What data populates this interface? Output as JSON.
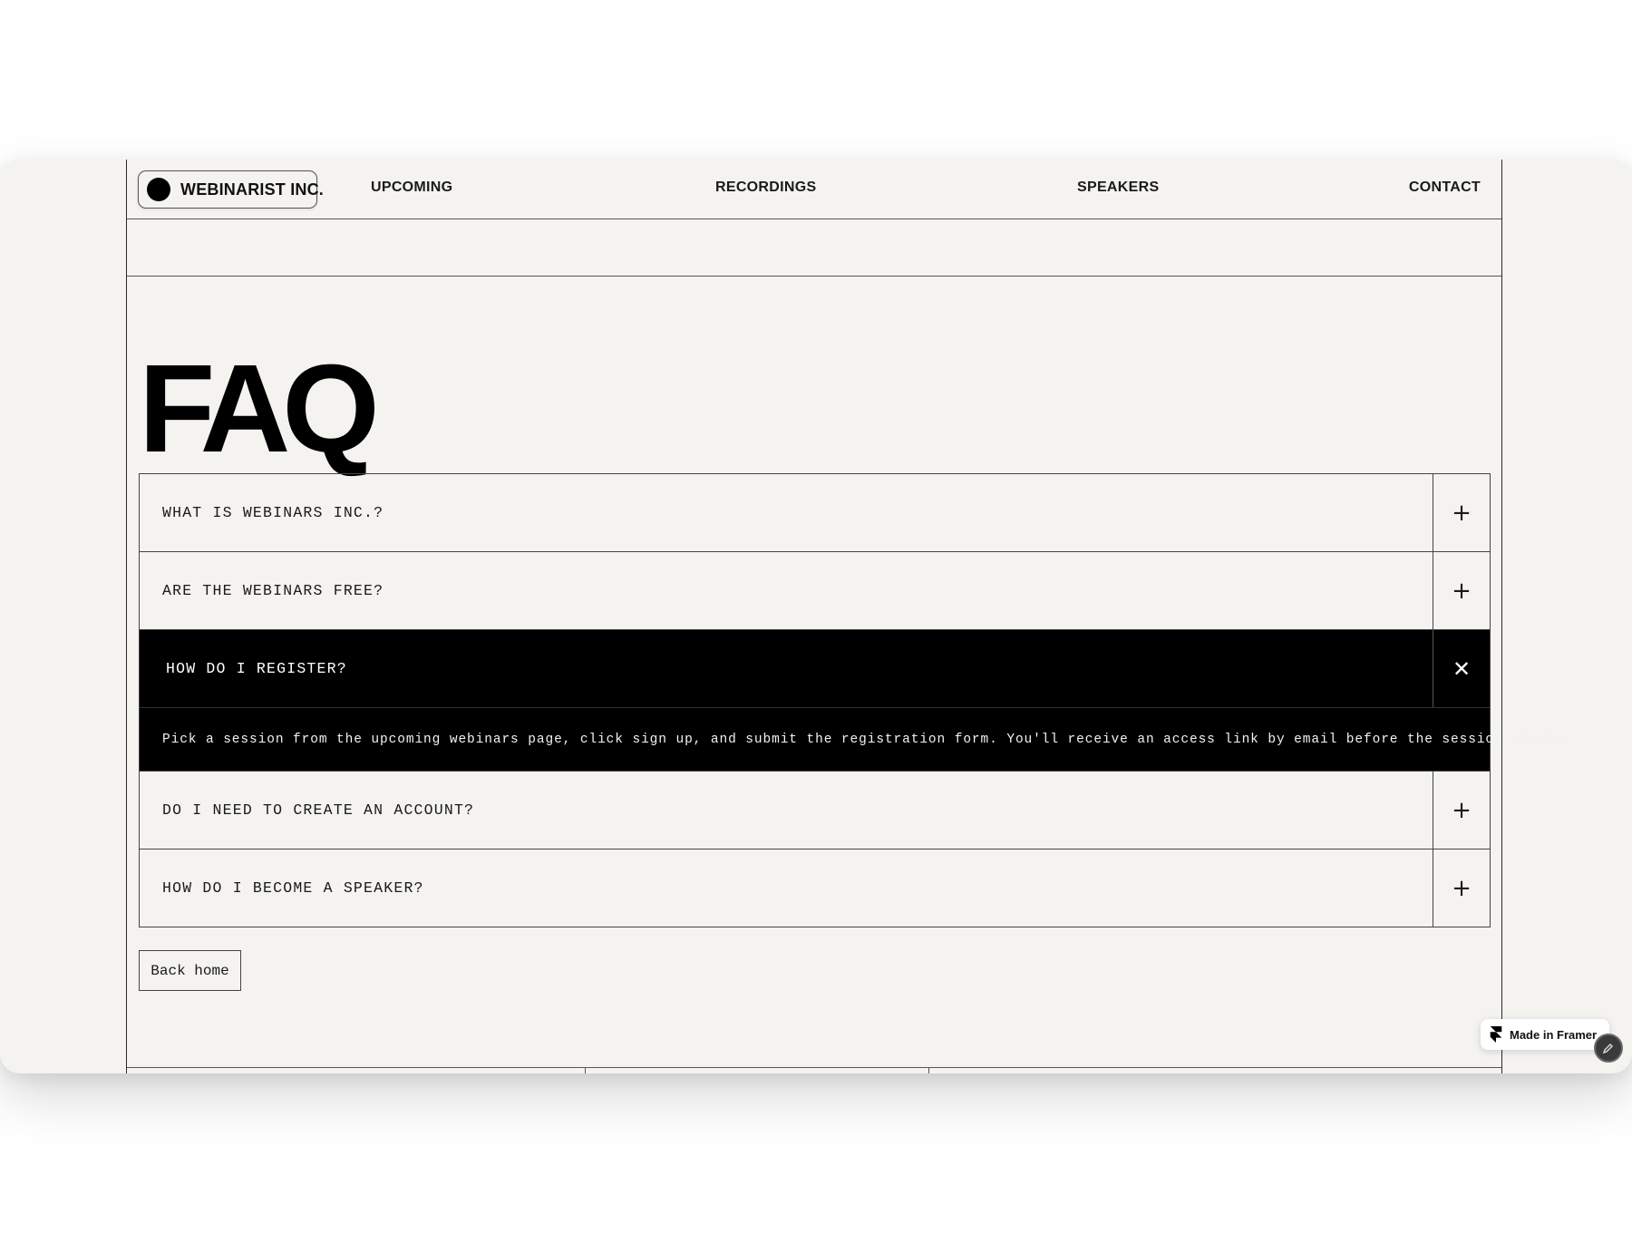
{
  "nav": {
    "logo_text": "WEBINARIST INC.",
    "links": [
      "UPCOMING",
      "RECORDINGS",
      "SPEAKERS",
      "CONTACT"
    ]
  },
  "page": {
    "title": "FAQ"
  },
  "faq": {
    "items": [
      {
        "question": "WHAT IS WEBINARS INC.?",
        "expanded": false,
        "toggle_icon": "plus-icon"
      },
      {
        "question": "ARE THE WEBINARS FREE?",
        "expanded": false,
        "toggle_icon": "plus-icon"
      },
      {
        "question": "HOW DO I REGISTER?",
        "expanded": true,
        "toggle_icon": "close-icon",
        "answer": "Pick a session from the upcoming webinars page, click sign up, and submit the registration form. You'll receive an access link by email before the session starts."
      },
      {
        "question": "DO I NEED TO CREATE AN ACCOUNT?",
        "expanded": false,
        "toggle_icon": "plus-icon"
      },
      {
        "question": "HOW DO I BECOME A SPEAKER?",
        "expanded": false,
        "toggle_icon": "plus-icon"
      }
    ]
  },
  "actions": {
    "back_home_label": "Back home"
  },
  "framer_badge": {
    "label": "Made in Framer"
  },
  "colors": {
    "page_bg": "#f4f3f0",
    "accent": "#000000",
    "border": "#444444"
  }
}
